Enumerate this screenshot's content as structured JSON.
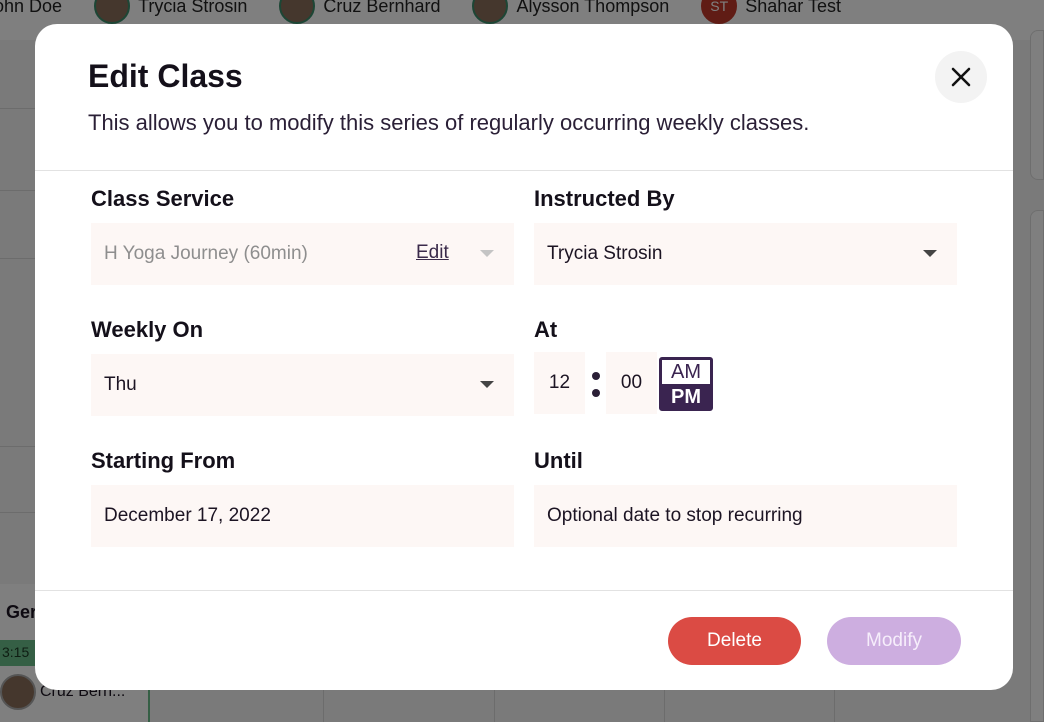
{
  "background": {
    "people": [
      {
        "name": "ohn Doe",
        "initials": ""
      },
      {
        "name": "Trycia Strosin",
        "initials": ""
      },
      {
        "name": "Cruz Bernhard",
        "initials": ""
      },
      {
        "name": "Alysson Thompson",
        "initials": ""
      },
      {
        "name": "Shahar Test",
        "initials": "ST"
      }
    ],
    "event": {
      "title": "Ger",
      "time": "3:15",
      "instructor": "Cruz Bern..."
    }
  },
  "modal": {
    "title": "Edit Class",
    "subtitle": "This allows you to modify this series of regularly occurring weekly classes.",
    "close_icon": "close-icon",
    "class_service": {
      "label": "Class Service",
      "value": "H Yoga Journey (60min)",
      "edit_label": "Edit",
      "disabled": true
    },
    "instructed_by": {
      "label": "Instructed By",
      "value": "Trycia Strosin"
    },
    "weekly_on": {
      "label": "Weekly On",
      "value": "Thu"
    },
    "at": {
      "label": "At",
      "hour": "12",
      "minute": "00",
      "am_label": "AM",
      "pm_label": "PM",
      "selected": "PM"
    },
    "starting_from": {
      "label": "Starting From",
      "value": "December 17, 2022"
    },
    "until": {
      "label": "Until",
      "placeholder": "Optional date to stop recurring",
      "value": ""
    },
    "buttons": {
      "delete": "Delete",
      "modify": "Modify"
    }
  },
  "colors": {
    "delete": "#db4b44",
    "modify_disabled": "#cdaee0",
    "accent": "#3a2450",
    "field_bg": "#fdf7f5"
  }
}
